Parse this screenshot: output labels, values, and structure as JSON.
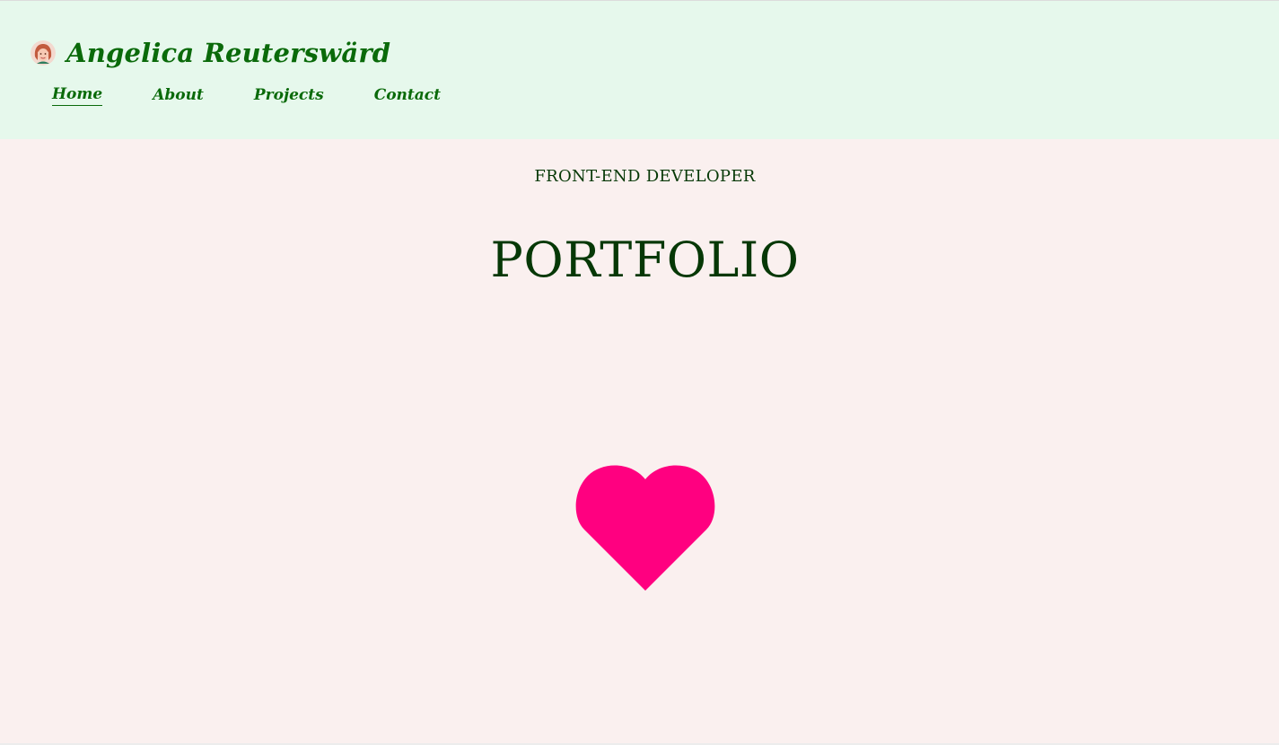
{
  "header": {
    "brand_name": "Angelica Reuterswärd",
    "nav": [
      {
        "label": "Home",
        "active": true
      },
      {
        "label": "About",
        "active": false
      },
      {
        "label": "Projects",
        "active": false
      },
      {
        "label": "Contact",
        "active": false
      }
    ]
  },
  "hero": {
    "subtitle": "FRONT-END DEVELOPER",
    "title": "PORTFOLIO"
  },
  "icons": {
    "avatar": "avatar-portrait",
    "heart": "heart-icon"
  },
  "colors": {
    "header_bg": "#e6f8ec",
    "page_bg": "#faf0ef",
    "brand_green": "#0a6a0a",
    "heading_green": "#063806",
    "heart_pink": "#ff0080"
  }
}
